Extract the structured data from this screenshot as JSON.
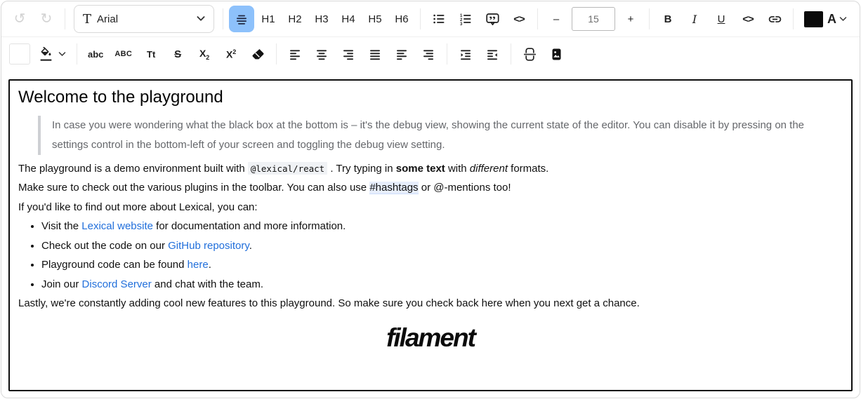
{
  "colors": {
    "accent_active_bg": "#8dc1fb",
    "link": "#216fdb",
    "quote_text": "#65676b",
    "quote_border": "#ced0d4",
    "code_bg": "#f0f2f5",
    "hashtag_bg": "#e7eefc",
    "disabled_icon": "#d3d3d3",
    "editor_border": "#0d0d0d",
    "swatch_black": "#0a0a0a"
  },
  "toolbar": {
    "undo_icon": "↺",
    "redo_icon": "↻",
    "font_family": {
      "glyph": "T",
      "value": "Arial"
    },
    "headings": [
      "H1",
      "H2",
      "H3",
      "H4",
      "H5",
      "H6"
    ],
    "font_size": {
      "decrement": "–",
      "value": "15",
      "increment": "+"
    },
    "format": {
      "bold": "B",
      "italic": "I",
      "underline": "U",
      "code": "<>"
    },
    "font_color_letter": "A",
    "case_buttons": {
      "lowercase": "abc",
      "uppercase": "ABC",
      "capitalize": "Tt",
      "strikethrough": "S",
      "subscript_base": "X",
      "subscript_script": "2",
      "superscript_base": "X",
      "superscript_script": "2"
    }
  },
  "editor": {
    "heading": "Welcome to the playground",
    "quote": "In case you were wondering what the black box at the bottom is – it's the debug view, showing the current state of the editor. You can disable it by pressing on the settings control in the bottom-left of your screen and toggling the debug view setting.",
    "paragraph1": [
      {
        "style": "text",
        "text": "The playground is a demo environment built with "
      },
      {
        "style": "code",
        "text": "@lexical/react"
      },
      {
        "style": "text",
        "text": " . Try typing in "
      },
      {
        "style": "bold",
        "text": "some text"
      },
      {
        "style": "text",
        "text": " with "
      },
      {
        "style": "italic",
        "text": "different"
      },
      {
        "style": "text",
        "text": " formats."
      }
    ],
    "paragraph2": [
      {
        "style": "text",
        "text": "Make sure to check out the various plugins in the toolbar. You can also use "
      },
      {
        "style": "hashtag",
        "text": "#hashtags"
      },
      {
        "style": "text",
        "text": " or @-mentions too!"
      }
    ],
    "paragraph3": "If you'd like to find out more about Lexical, you can:",
    "bullets": [
      [
        {
          "style": "text",
          "text": "Visit the "
        },
        {
          "style": "link",
          "text": "Lexical website"
        },
        {
          "style": "text",
          "text": " for documentation and more information."
        }
      ],
      [
        {
          "style": "text",
          "text": "Check out the code on our "
        },
        {
          "style": "link",
          "text": "GitHub repository"
        },
        {
          "style": "text",
          "text": "."
        }
      ],
      [
        {
          "style": "text",
          "text": "Playground code can be found "
        },
        {
          "style": "link",
          "text": "here"
        },
        {
          "style": "text",
          "text": "."
        }
      ],
      [
        {
          "style": "text",
          "text": "Join our "
        },
        {
          "style": "link",
          "text": "Discord Server"
        },
        {
          "style": "text",
          "text": " and chat with the team."
        }
      ]
    ],
    "paragraph4": "Lastly, we're constantly adding cool new features to this playground. So make sure you check back here when you next get a chance.",
    "logo_text": "filament"
  }
}
